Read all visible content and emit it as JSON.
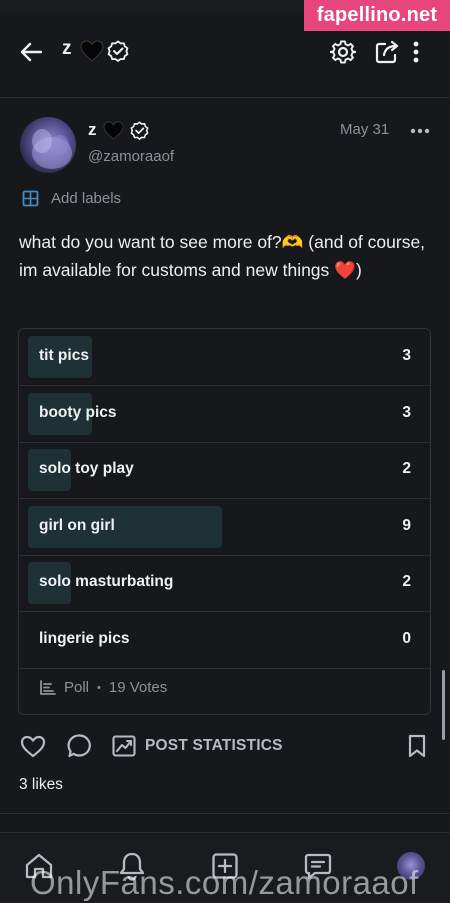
{
  "watermark": {
    "top": "fapellino.net",
    "bottom": "OnlyFans.com/zamoraaof"
  },
  "header": {
    "title": "z"
  },
  "post": {
    "author_name": "z",
    "handle": "@zamoraaof",
    "date": "May 31",
    "add_labels": "Add labels",
    "text": "what do you want to see more of?🫶 (and of course, im available for customs and new things ❤️)"
  },
  "poll": {
    "options": [
      {
        "label": "tit pics",
        "count": "3",
        "share": 0.33
      },
      {
        "label": "booty pics",
        "count": "3",
        "share": 0.33
      },
      {
        "label": "solo toy play",
        "count": "2",
        "share": 0.22
      },
      {
        "label": "girl on girl",
        "count": "9",
        "share": 1.0
      },
      {
        "label": "solo masturbating",
        "count": "2",
        "share": 0.22
      },
      {
        "label": "lingerie pics",
        "count": "0",
        "share": 0.0
      }
    ],
    "footer_type": "Poll",
    "footer_sep": "•",
    "votes": "19 Votes"
  },
  "actions": {
    "stats_label": "POST STATISTICS",
    "likes": "3 likes"
  },
  "colors": {
    "accent_fill": "#1e3236",
    "background": "#17181b",
    "watermark_pink": "#e7467c"
  },
  "icons": [
    "back-arrow-icon",
    "heart-icon",
    "verified-badge-icon",
    "gear-icon",
    "share-icon",
    "more-vertical-icon",
    "more-horizontal-icon",
    "label-icon",
    "poll-icon",
    "like-icon",
    "comment-icon",
    "stats-icon",
    "bookmark-icon",
    "home-icon",
    "bell-icon",
    "add-post-icon",
    "messages-icon"
  ]
}
